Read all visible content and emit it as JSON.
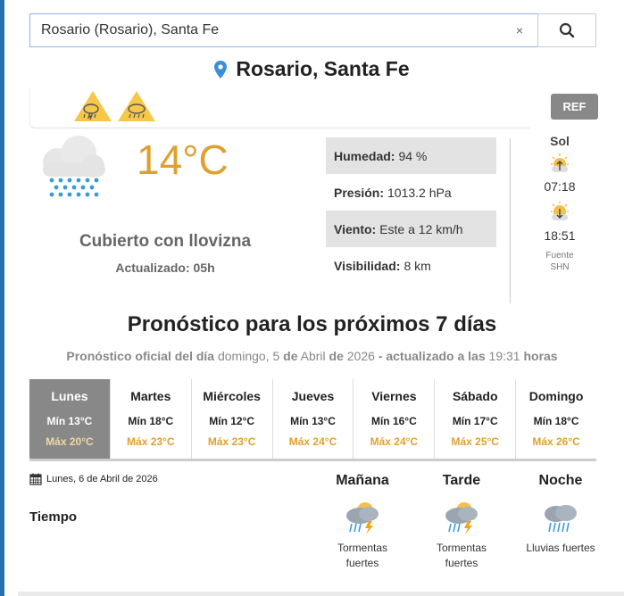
{
  "search": {
    "value": "Rosario (Rosario), Santa Fe",
    "clear_label": "×"
  },
  "location": {
    "title": "Rosario, Santa Fe"
  },
  "alerts": [
    {
      "icon": "storm-alert-icon"
    },
    {
      "icon": "rain-alert-icon"
    }
  ],
  "ref_label": "REF",
  "current": {
    "temperature": "14°C",
    "condition": "Cubierto con llovizna",
    "updated": "Actualizado: 05h"
  },
  "stats": [
    {
      "label": "Humedad:",
      "value": "94 %"
    },
    {
      "label": "Presión:",
      "value": "1013.2 hPa"
    },
    {
      "label": "Viento:",
      "value": "Este a 12 km/h"
    },
    {
      "label": "Visibilidad:",
      "value": "8 km"
    }
  ],
  "sun": {
    "title": "Sol",
    "sunrise": "07:18",
    "sunset": "18:51",
    "source_label": "Fuente",
    "source": "SHN"
  },
  "forecast": {
    "title": "Pronóstico para los próximos 7 días",
    "sub_prefix": "Pronóstico oficial del día",
    "sub_weekday": "domingo, 5",
    "sub_de1": "de",
    "sub_month": "Abril",
    "sub_de2": "de",
    "sub_year": "2026",
    "sub_updated": "- actualizado a las",
    "sub_time": "19:31",
    "sub_hours": "horas",
    "days": [
      {
        "name": "Lunes",
        "min": "Mín 13°C",
        "max": "Máx 20°C"
      },
      {
        "name": "Martes",
        "min": "Mín 18°C",
        "max": "Máx 23°C"
      },
      {
        "name": "Miércoles",
        "min": "Mín 12°C",
        "max": "Máx 23°C"
      },
      {
        "name": "Jueves",
        "min": "Mín 13°C",
        "max": "Máx 24°C"
      },
      {
        "name": "Viernes",
        "min": "Mín 16°C",
        "max": "Máx 24°C"
      },
      {
        "name": "Sábado",
        "min": "Mín 17°C",
        "max": "Máx 25°C"
      },
      {
        "name": "Domingo",
        "min": "Mín 18°C",
        "max": "Máx 26°C"
      }
    ]
  },
  "detail": {
    "date": "Lunes, 6 de Abril de 2026",
    "tiempo_label": "Tiempo",
    "periods": [
      {
        "name": "Mañana",
        "desc_line1": "Tormentas",
        "desc_line2": "fuertes",
        "icon": "storm-cloud-icon"
      },
      {
        "name": "Tarde",
        "desc_line1": "Tormentas",
        "desc_line2": "fuertes",
        "icon": "storm-cloud-icon"
      },
      {
        "name": "Noche",
        "desc_line1": "Lluvias fuertes",
        "desc_line2": "",
        "icon": "heavy-rain-cloud-icon"
      }
    ]
  },
  "colors": {
    "accent": "#e0a030",
    "link": "#3a8fd8",
    "active_day": "#888888"
  }
}
